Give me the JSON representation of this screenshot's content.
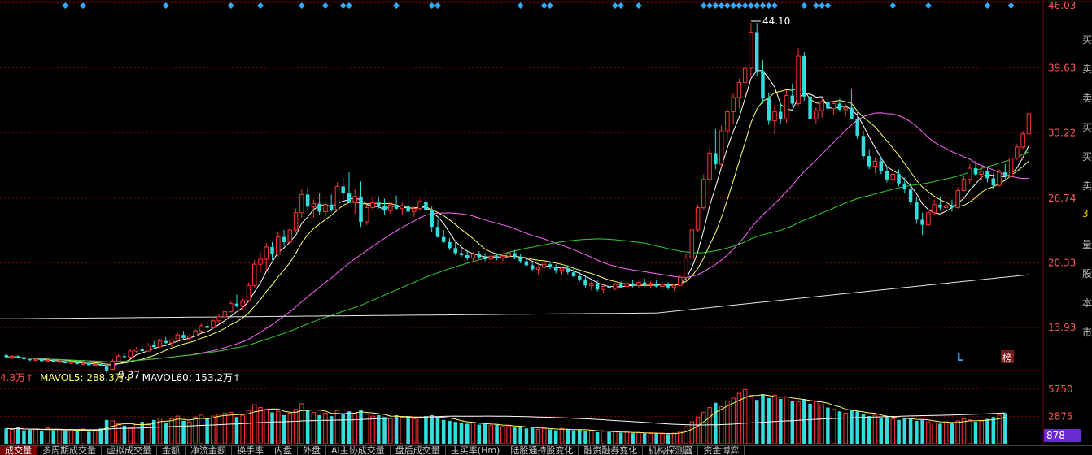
{
  "chart_data": {
    "type": "candlestick",
    "title": "",
    "y_axis": {
      "ticks": [
        "46.03",
        "39.63",
        "33.22",
        "26.74",
        "20.33",
        "13.93"
      ],
      "ylim": [
        10.0,
        46.03
      ]
    },
    "annotations": {
      "high_label": "44.10",
      "low_label": "9.37"
    },
    "markers": {
      "l_marker": "L",
      "bang_marker": "榜"
    },
    "ohlc": [
      [
        11.2,
        11.3,
        10.9,
        11.0
      ],
      [
        11.0,
        11.2,
        10.8,
        11.1
      ],
      [
        11.1,
        11.2,
        10.9,
        10.9
      ],
      [
        10.9,
        11.0,
        10.7,
        10.8
      ],
      [
        10.8,
        10.9,
        10.6,
        10.7
      ],
      [
        10.7,
        10.9,
        10.6,
        10.8
      ],
      [
        10.8,
        10.9,
        10.6,
        10.6
      ],
      [
        10.6,
        10.8,
        10.5,
        10.7
      ],
      [
        10.7,
        10.8,
        10.5,
        10.5
      ],
      [
        10.5,
        10.7,
        10.4,
        10.6
      ],
      [
        10.6,
        10.7,
        10.4,
        10.4
      ],
      [
        10.4,
        10.6,
        10.3,
        10.5
      ],
      [
        10.5,
        10.6,
        10.3,
        10.3
      ],
      [
        10.3,
        10.5,
        10.2,
        10.4
      ],
      [
        10.4,
        10.5,
        10.2,
        10.2
      ],
      [
        10.2,
        10.4,
        10.1,
        10.3
      ],
      [
        10.3,
        10.4,
        10.1,
        10.1
      ],
      [
        10.1,
        10.2,
        9.4,
        9.7
      ],
      [
        9.8,
        10.8,
        9.8,
        10.6
      ],
      [
        10.6,
        11.3,
        10.5,
        11.1
      ],
      [
        11.1,
        11.4,
        10.9,
        11.0
      ],
      [
        11.0,
        11.8,
        10.9,
        11.6
      ],
      [
        11.6,
        12.0,
        11.4,
        11.8
      ],
      [
        11.8,
        12.1,
        11.5,
        11.6
      ],
      [
        11.6,
        12.4,
        11.5,
        12.2
      ],
      [
        12.2,
        12.6,
        11.9,
        12.0
      ],
      [
        12.0,
        12.8,
        11.9,
        12.6
      ],
      [
        12.6,
        13.0,
        12.3,
        12.4
      ],
      [
        12.4,
        12.8,
        12.0,
        12.7
      ],
      [
        12.7,
        13.4,
        12.5,
        13.2
      ],
      [
        13.2,
        13.6,
        12.8,
        12.9
      ],
      [
        12.9,
        13.3,
        12.6,
        13.1
      ],
      [
        13.1,
        13.8,
        13.0,
        13.6
      ],
      [
        13.6,
        14.4,
        13.4,
        14.1
      ],
      [
        14.1,
        14.6,
        13.7,
        13.9
      ],
      [
        13.9,
        14.8,
        13.8,
        14.6
      ],
      [
        14.6,
        15.3,
        14.3,
        15.0
      ],
      [
        15.0,
        15.8,
        14.7,
        15.5
      ],
      [
        15.5,
        16.6,
        15.4,
        16.3
      ],
      [
        16.3,
        17.2,
        15.9,
        16.1
      ],
      [
        16.1,
        16.8,
        15.6,
        16.6
      ],
      [
        16.6,
        18.4,
        16.5,
        18.1
      ],
      [
        18.1,
        20.6,
        17.8,
        20.2
      ],
      [
        20.2,
        21.4,
        19.4,
        20.7
      ],
      [
        20.7,
        22.3,
        19.6,
        21.9
      ],
      [
        21.9,
        22.4,
        20.6,
        21.2
      ],
      [
        21.2,
        23.4,
        21.0,
        22.9
      ],
      [
        22.9,
        23.6,
        22.0,
        22.4
      ],
      [
        22.4,
        23.9,
        22.1,
        23.6
      ],
      [
        23.6,
        25.7,
        23.4,
        25.3
      ],
      [
        25.3,
        27.6,
        24.8,
        27.1
      ],
      [
        27.1,
        27.8,
        25.6,
        25.9
      ],
      [
        25.9,
        26.6,
        24.8,
        26.2
      ],
      [
        26.2,
        27.2,
        25.1,
        25.4
      ],
      [
        25.4,
        26.4,
        24.9,
        26.1
      ],
      [
        26.1,
        27.1,
        25.4,
        25.6
      ],
      [
        25.6,
        28.3,
        25.5,
        27.9
      ],
      [
        27.9,
        28.8,
        26.6,
        27.2
      ],
      [
        27.2,
        29.3,
        26.9,
        26.3
      ],
      [
        26.3,
        27.6,
        25.2,
        26.9
      ],
      [
        26.9,
        28.4,
        23.9,
        24.4
      ],
      [
        24.4,
        26.1,
        24.1,
        25.8
      ],
      [
        25.8,
        26.8,
        25.5,
        26.3
      ],
      [
        26.3,
        26.9,
        25.7,
        26.0
      ],
      [
        26.0,
        26.7,
        25.1,
        25.5
      ],
      [
        25.5,
        26.3,
        25.2,
        26.1
      ],
      [
        26.1,
        27.0,
        25.6,
        25.7
      ],
      [
        25.7,
        26.3,
        25.1,
        26.0
      ],
      [
        26.0,
        27.3,
        25.8,
        25.4
      ],
      [
        25.4,
        25.9,
        24.9,
        25.7
      ],
      [
        25.7,
        26.6,
        25.5,
        26.4
      ],
      [
        26.4,
        27.6,
        25.9,
        25.6
      ],
      [
        25.6,
        25.9,
        23.4,
        23.9
      ],
      [
        23.9,
        24.6,
        22.8,
        22.9
      ],
      [
        22.9,
        23.6,
        22.3,
        22.4
      ],
      [
        22.4,
        22.8,
        21.6,
        21.8
      ],
      [
        21.8,
        22.4,
        21.1,
        21.3
      ],
      [
        21.3,
        21.8,
        20.9,
        21.1
      ],
      [
        21.1,
        21.6,
        20.6,
        20.8
      ],
      [
        20.8,
        21.4,
        20.5,
        21.2
      ],
      [
        21.2,
        21.5,
        20.7,
        20.9
      ],
      [
        20.9,
        21.3,
        20.5,
        20.7
      ],
      [
        20.7,
        21.2,
        20.4,
        21.0
      ],
      [
        21.0,
        21.3,
        20.6,
        20.8
      ],
      [
        20.8,
        21.2,
        20.5,
        21.0
      ],
      [
        21.0,
        21.5,
        20.8,
        21.3
      ],
      [
        21.3,
        21.6,
        20.7,
        20.9
      ],
      [
        20.9,
        21.2,
        20.3,
        20.5
      ],
      [
        20.5,
        20.8,
        19.9,
        20.1
      ],
      [
        20.1,
        20.4,
        19.5,
        19.7
      ],
      [
        19.7,
        20.1,
        19.2,
        19.9
      ],
      [
        19.9,
        20.4,
        19.6,
        20.2
      ],
      [
        20.2,
        20.5,
        19.7,
        19.9
      ],
      [
        19.9,
        20.2,
        19.3,
        19.6
      ],
      [
        19.6,
        20.0,
        19.1,
        19.8
      ],
      [
        19.8,
        20.1,
        19.2,
        19.4
      ],
      [
        19.4,
        19.8,
        18.9,
        19.0
      ],
      [
        19.0,
        19.4,
        18.5,
        18.7
      ],
      [
        18.7,
        19.0,
        17.8,
        18.1
      ],
      [
        18.1,
        18.5,
        17.6,
        18.3
      ],
      [
        18.3,
        18.6,
        17.5,
        17.7
      ],
      [
        17.7,
        18.2,
        17.4,
        18.0
      ],
      [
        18.0,
        18.3,
        17.5,
        17.8
      ],
      [
        17.8,
        18.4,
        17.6,
        18.2
      ],
      [
        18.2,
        18.5,
        17.8,
        18.0
      ],
      [
        18.0,
        18.4,
        17.7,
        18.3
      ],
      [
        18.3,
        18.6,
        17.9,
        18.1
      ],
      [
        18.1,
        18.5,
        17.8,
        18.4
      ],
      [
        18.4,
        18.8,
        18.0,
        18.2
      ],
      [
        18.2,
        18.5,
        17.8,
        18.3
      ],
      [
        18.3,
        18.6,
        17.9,
        18.0
      ],
      [
        18.0,
        18.4,
        17.7,
        18.2
      ],
      [
        18.2,
        18.4,
        17.7,
        17.9
      ],
      [
        17.9,
        18.3,
        17.6,
        18.1
      ],
      [
        18.1,
        19.1,
        18.0,
        18.9
      ],
      [
        18.9,
        21.2,
        18.8,
        20.8
      ],
      [
        20.8,
        23.8,
        20.7,
        23.6
      ],
      [
        23.6,
        26.1,
        23.4,
        25.8
      ],
      [
        25.8,
        29.1,
        25.6,
        28.6
      ],
      [
        28.6,
        31.8,
        28.3,
        31.2
      ],
      [
        31.2,
        33.6,
        29.6,
        30.1
      ],
      [
        30.1,
        33.9,
        29.8,
        33.4
      ],
      [
        33.4,
        35.6,
        32.4,
        35.3
      ],
      [
        35.3,
        37.1,
        34.1,
        36.7
      ],
      [
        36.7,
        38.6,
        35.6,
        38.2
      ],
      [
        38.2,
        40.1,
        36.9,
        39.6
      ],
      [
        39.6,
        44.1,
        38.7,
        43.1
      ],
      [
        43.1,
        44.1,
        38.8,
        39.3
      ],
      [
        39.3,
        40.4,
        36.1,
        36.6
      ],
      [
        36.6,
        37.2,
        34.0,
        34.4
      ],
      [
        34.4,
        35.8,
        33.1,
        35.3
      ],
      [
        35.3,
        36.2,
        34.1,
        34.6
      ],
      [
        34.6,
        37.4,
        34.2,
        36.9
      ],
      [
        36.9,
        38.1,
        35.8,
        36.1
      ],
      [
        36.1,
        41.6,
        35.8,
        40.8
      ],
      [
        40.8,
        41.2,
        36.4,
        36.8
      ],
      [
        36.8,
        37.3,
        34.3,
        34.6
      ],
      [
        34.6,
        35.7,
        34.1,
        35.4
      ],
      [
        35.4,
        36.6,
        34.7,
        36.3
      ],
      [
        36.3,
        36.8,
        35.2,
        35.6
      ],
      [
        35.6,
        36.4,
        35.0,
        36.1
      ],
      [
        36.1,
        36.6,
        35.3,
        35.5
      ],
      [
        35.5,
        36.1,
        34.8,
        35.7
      ],
      [
        35.7,
        37.6,
        35.4,
        34.6
      ],
      [
        34.6,
        35.3,
        32.6,
        32.9
      ],
      [
        32.9,
        33.4,
        30.6,
        30.9
      ],
      [
        30.9,
        31.6,
        29.6,
        29.9
      ],
      [
        29.9,
        30.8,
        29.2,
        30.4
      ],
      [
        30.4,
        30.9,
        29.1,
        29.4
      ],
      [
        29.4,
        29.9,
        28.3,
        28.6
      ],
      [
        28.6,
        29.4,
        28.1,
        29.1
      ],
      [
        29.1,
        29.6,
        27.9,
        28.2
      ],
      [
        28.2,
        28.8,
        27.2,
        27.6
      ],
      [
        27.6,
        28.3,
        26.1,
        26.4
      ],
      [
        26.4,
        26.9,
        24.2,
        24.6
      ],
      [
        24.6,
        25.3,
        23.1,
        24.1
      ],
      [
        24.1,
        25.6,
        24.0,
        25.3
      ],
      [
        25.3,
        26.6,
        25.1,
        26.1
      ],
      [
        26.1,
        26.9,
        25.5,
        25.8
      ],
      [
        25.8,
        26.4,
        25.6,
        26.0
      ],
      [
        26.0,
        26.6,
        25.4,
        25.8
      ],
      [
        25.8,
        27.8,
        25.7,
        27.5
      ],
      [
        27.5,
        28.9,
        27.4,
        28.6
      ],
      [
        28.6,
        30.1,
        28.2,
        29.7
      ],
      [
        29.7,
        30.4,
        28.9,
        29.1
      ],
      [
        29.1,
        29.9,
        28.5,
        29.4
      ],
      [
        29.4,
        29.8,
        28.3,
        28.7
      ],
      [
        28.7,
        29.2,
        27.7,
        28.0
      ],
      [
        28.0,
        29.6,
        27.9,
        29.3
      ],
      [
        29.3,
        30.1,
        28.6,
        28.9
      ],
      [
        28.9,
        30.9,
        28.8,
        30.7
      ],
      [
        30.7,
        32.1,
        30.5,
        31.8
      ],
      [
        31.8,
        33.4,
        31.6,
        33.1
      ],
      [
        33.1,
        35.6,
        32.9,
        35.1
      ]
    ],
    "series": [
      {
        "name": "MA5",
        "color": "#ffffff"
      },
      {
        "name": "MA10",
        "color": "#ffff66"
      },
      {
        "name": "MA30",
        "color": "#ff66ff"
      },
      {
        "name": "MA60",
        "color": "#33cc33"
      },
      {
        "name": "MA250",
        "color": "#e8e8e8"
      }
    ],
    "volume": {
      "ticks": [
        "5750",
        "2875"
      ],
      "current_label": "878",
      "legend": [
        {
          "text": "4.8万↑",
          "color": "#ff4d4d"
        },
        {
          "text": "MAVOL5: 288.3万↓",
          "color": "#ffff66"
        },
        {
          "text": "MAVOL60: 153.2万↑",
          "color": "#ffffff"
        }
      ],
      "values": [
        1600,
        1500,
        1700,
        1400,
        1450,
        1550,
        1350,
        1650,
        1400,
        1500,
        1300,
        1450,
        1350,
        1550,
        1250,
        1400,
        1600,
        2500,
        2400,
        2100,
        1900,
        1700,
        2000,
        2300,
        2100,
        2500,
        2700,
        2200,
        2600,
        2900,
        2400,
        2300,
        2800,
        3000,
        2600,
        2900,
        3100,
        3200,
        3300,
        2800,
        3000,
        3500,
        4100,
        3800,
        3600,
        3300,
        3400,
        3000,
        3200,
        3600,
        4200,
        3500,
        3300,
        3000,
        3200,
        2900,
        3500,
        3100,
        3400,
        3200,
        3600,
        3100,
        2900,
        3000,
        2800,
        2700,
        3000,
        2800,
        2900,
        2600,
        2700,
        2900,
        3000,
        2700,
        2500,
        2400,
        2300,
        2200,
        2100,
        2200,
        2000,
        2100,
        1900,
        2000,
        1800,
        1900,
        1700,
        1800,
        1600,
        1700,
        1500,
        1600,
        1500,
        1400,
        1600,
        1500,
        1400,
        1500,
        1300,
        1400,
        1200,
        1300,
        1200,
        1250,
        1150,
        1200,
        1100,
        1150,
        1100,
        1050,
        1100,
        1050,
        1000,
        1100,
        1300,
        1800,
        2300,
        2800,
        3300,
        3800,
        4300,
        3900,
        4500,
        4800,
        5300,
        5700,
        5000,
        4600,
        5200,
        4800,
        5100,
        4700,
        4900,
        4500,
        4400,
        4700,
        4200,
        4500,
        4100,
        3800,
        3600,
        3400,
        3200,
        3600,
        3400,
        3100,
        2900,
        3000,
        2700,
        2800,
        2600,
        2500,
        2700,
        2600,
        2400,
        2500,
        2300,
        2200,
        2100,
        2300,
        2200,
        2400,
        2600,
        2500,
        2300,
        2400,
        2600,
        2800,
        3000,
        3200
      ]
    }
  },
  "tabs": [
    "成交量",
    "多周期成交量",
    "虚拟成交量",
    "金额",
    "净流金额",
    "换手率",
    "内盘",
    "外盘",
    "AI主协成交量",
    "盘后成交量",
    "主买率(Hm)",
    "陆股通持股变化",
    "融资融券变化",
    "机构探测器",
    "资金博弈"
  ],
  "active_tab_index": 0,
  "right_strip_chars": [
    "买",
    "卖",
    "卖",
    "买",
    "买",
    "卖",
    "3",
    "量",
    "股",
    "本",
    "市"
  ]
}
